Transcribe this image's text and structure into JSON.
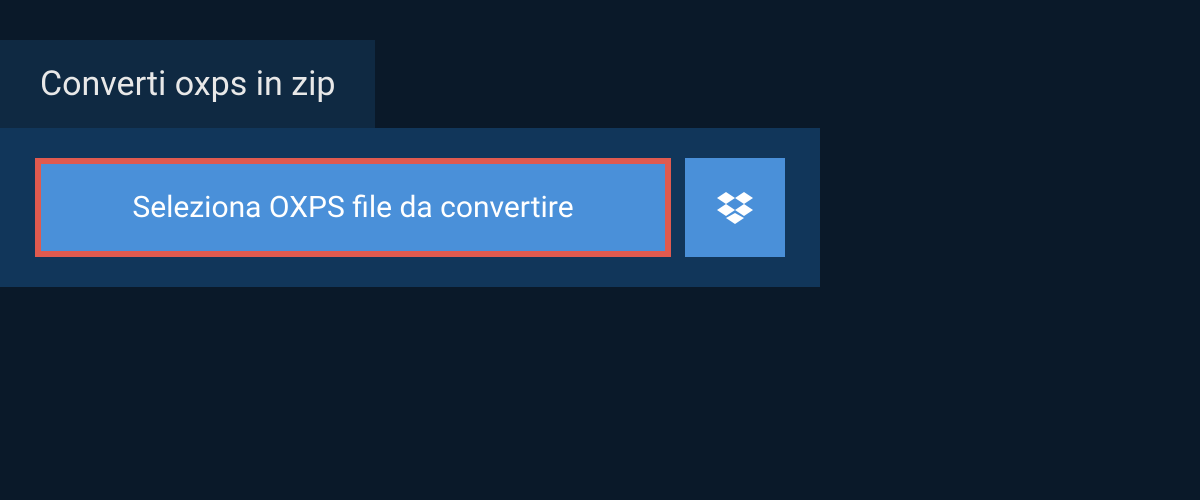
{
  "tab": {
    "title": "Converti oxps in zip"
  },
  "buttons": {
    "select_label": "Seleziona OXPS file da convertire"
  },
  "icons": {
    "dropbox": "dropbox-icon"
  },
  "colors": {
    "background_dark": "#0a1929",
    "tab_background": "#0f2942",
    "panel_background": "#11365a",
    "button_blue": "#4a90d9",
    "highlight_border": "#e05a4f",
    "text_light": "#e8e8e8",
    "text_white": "#ffffff"
  }
}
